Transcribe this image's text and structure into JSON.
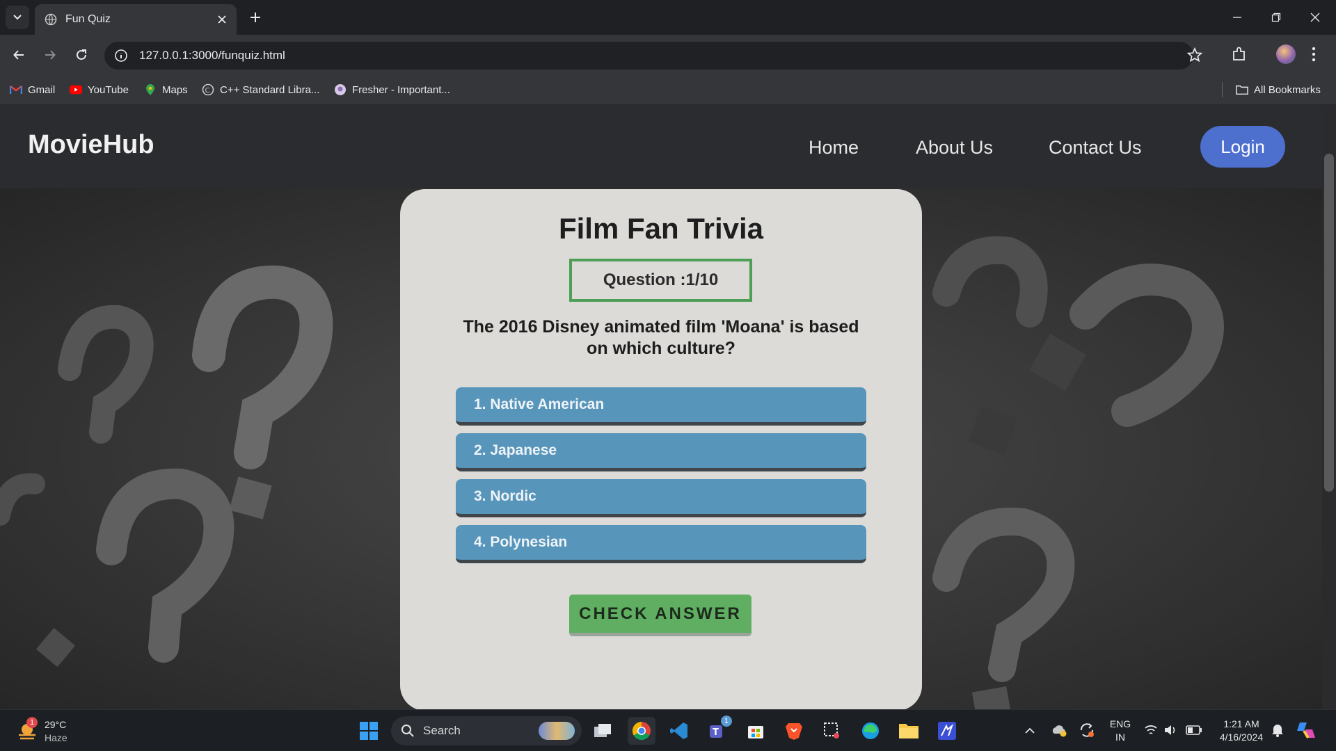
{
  "browser": {
    "tab_title": "Fun Quiz",
    "url": "127.0.0.1:3000/funquiz.html",
    "bookmarks": [
      {
        "label": "Gmail",
        "icon": "gmail-icon"
      },
      {
        "label": "YouTube",
        "icon": "youtube-icon"
      },
      {
        "label": "Maps",
        "icon": "maps-icon"
      },
      {
        "label": "C++ Standard Libra...",
        "icon": "cpp-icon"
      },
      {
        "label": "Fresher - Important...",
        "icon": "fresher-icon"
      }
    ],
    "all_bookmarks": "All Bookmarks"
  },
  "site": {
    "brand": "MovieHub",
    "nav": [
      "Home",
      "About Us",
      "Contact Us"
    ],
    "login": "Login"
  },
  "quiz": {
    "title": "Film Fan Trivia",
    "question_counter": "Question :1/10",
    "question": "The 2016 Disney animated film 'Moana' is based on which culture?",
    "options": [
      "1. Native American",
      "2. Japanese",
      "3. Nordic",
      "4. Polynesian"
    ],
    "check_button": "CHECK ANSWER",
    "colors": {
      "option": "#5895ba",
      "check": "#5fae62",
      "login": "#4d6fce"
    }
  },
  "taskbar": {
    "weather_temp": "29°C",
    "weather_desc": "Haze",
    "weather_badge": "1",
    "search": "Search",
    "teams_badge": "1",
    "lang_top": "ENG",
    "lang_bottom": "IN",
    "time": "1:21 AM",
    "date": "4/16/2024"
  }
}
